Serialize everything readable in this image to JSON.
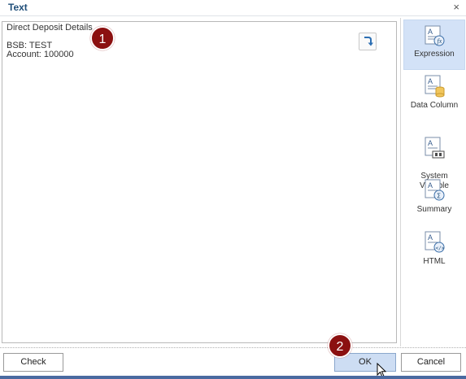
{
  "dialog": {
    "title": "Text",
    "close_symbol": "×"
  },
  "editor": {
    "content": "Direct Deposit Details\n\nBSB: TEST\nAccount: 100000",
    "wrap_icon": "wrap-arrow-icon"
  },
  "sidebar": {
    "items": [
      {
        "label": "Expression",
        "icon": "expression-icon",
        "active": true
      },
      {
        "label": "Data Column",
        "icon": "data-column-icon",
        "active": false
      },
      {
        "label": "System\nVariable",
        "icon": "system-variable-icon",
        "active": false
      },
      {
        "label": "Summary",
        "icon": "summary-icon",
        "active": false
      },
      {
        "label": "HTML",
        "icon": "html-icon",
        "active": false
      }
    ]
  },
  "footer": {
    "check_label": "Check",
    "ok_label": "OK",
    "cancel_label": "Cancel"
  },
  "callouts": {
    "one": "1",
    "two": "2"
  },
  "colors": {
    "title": "#1f4e79",
    "active_bg": "#d3e2f7",
    "badge": "#8b1010",
    "ok_bg": "#cdddf3"
  }
}
